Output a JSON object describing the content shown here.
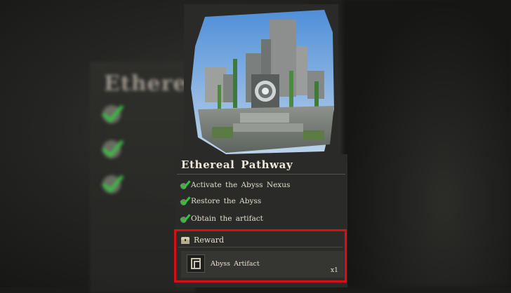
{
  "quest": {
    "title": "Ethereal Pathway",
    "objectives": [
      {
        "label": "Activate the Abyss Nexus",
        "completed": true
      },
      {
        "label": "Restore the Abyss",
        "completed": true
      },
      {
        "label": "Obtain the artifact",
        "completed": true
      }
    ]
  },
  "reward": {
    "heading": "Reward",
    "item": {
      "name": "Abyss Artifact",
      "quantity": "x1"
    }
  },
  "background": {
    "blurred_title": "Ethereal"
  },
  "colors": {
    "check_green": "#2fc23a",
    "highlight_red": "#e00d10",
    "panel": "#2a2a28"
  }
}
